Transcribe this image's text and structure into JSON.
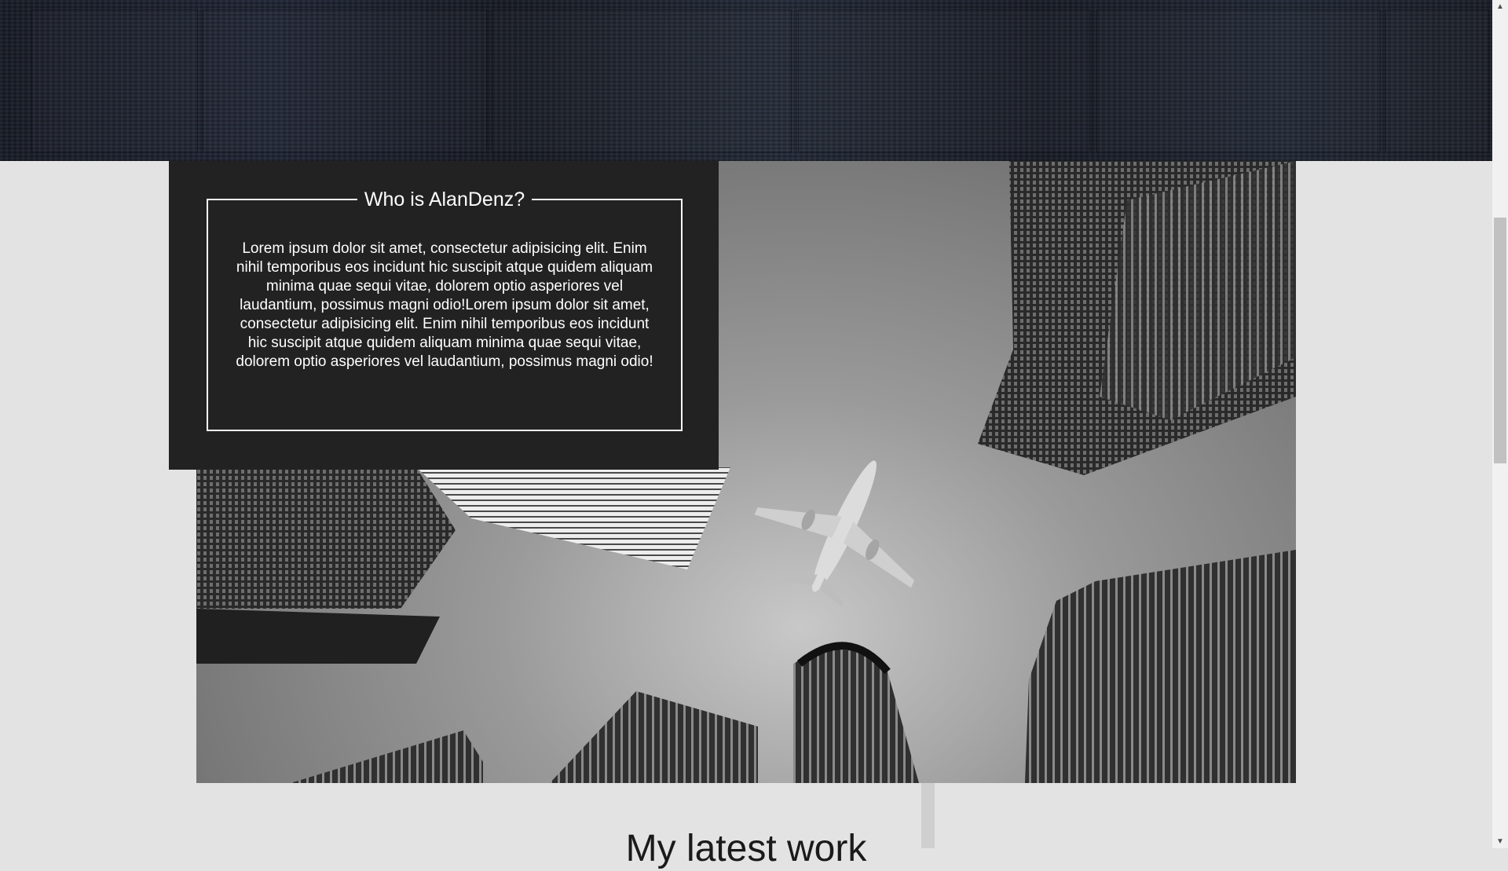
{
  "about": {
    "title": "Who is AlanDenz?",
    "body": "Lorem ipsum dolor sit amet, consectetur adipisicing elit. Enim nihil temporibus eos incidunt hic suscipit atque quidem aliquam minima quae sequi vitae, dolorem optio asperiores vel laudantium, possimus magni odio!Lorem ipsum dolor sit amet, consectetur adipisicing elit. Enim nihil temporibus eos incidunt hic suscipit atque quidem aliquam minima quae sequi vitae, dolorem optio asperiores vel laudantium, possimus magni odio!"
  },
  "latest_work": {
    "heading": "My latest work"
  },
  "scrollbar": {
    "up_icon": "scroll-up-arrow-icon",
    "down_icon": "scroll-down-arrow-icon",
    "up_glyph": "▲",
    "down_glyph": "▼"
  },
  "colors": {
    "page_background": "#e3e3e3",
    "about_panel": "#222222",
    "about_text": "#ffffff",
    "hero_dark": "#1b1f2a"
  }
}
